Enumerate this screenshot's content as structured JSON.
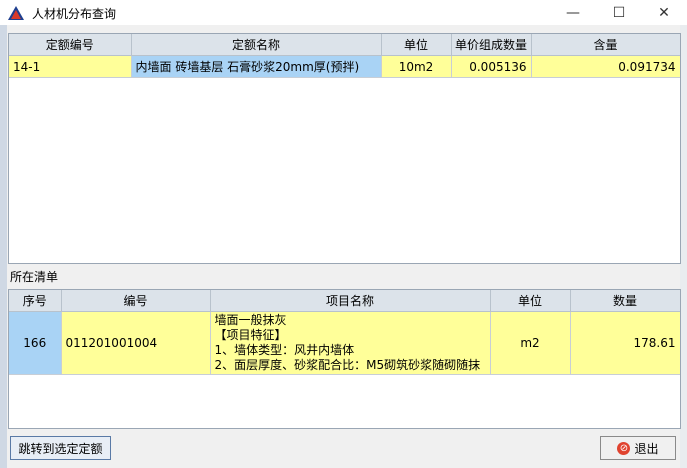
{
  "window": {
    "title": "人材机分布查询",
    "minimize_icon": "minimize-icon",
    "maximize_icon": "maximize-icon",
    "close_icon": "close-icon"
  },
  "quota_table": {
    "columns": [
      "定额编号",
      "定额名称",
      "单位",
      "单价组成数量",
      "含量"
    ],
    "rows": [
      {
        "code": "14-1",
        "name": "内墙面 砖墙基层 石膏砂浆20mm厚(预拌)",
        "unit": "10m2",
        "qty": "0.005136",
        "content": "0.091734"
      }
    ]
  },
  "list_section": {
    "label": "所在清单",
    "columns": [
      "序号",
      "编号",
      "项目名称",
      "单位",
      "数量"
    ],
    "rows": [
      {
        "seq": "166",
        "code": "011201001004",
        "name_lines": [
          "墙面一般抹灰",
          "【项目特征】",
          "1、墙体类型：风井内墙体",
          "2、面层厚度、砂浆配合比：M5砌筑砂浆随砌随抹"
        ],
        "unit": "m2",
        "qty": "178.61"
      }
    ]
  },
  "buttons": {
    "jump": "跳转到选定定额",
    "exit": "退出"
  },
  "colors": {
    "row_yellow": "#ffff99",
    "selected_blue": "#a9d3f5",
    "header_gray": "#dce3ea"
  }
}
